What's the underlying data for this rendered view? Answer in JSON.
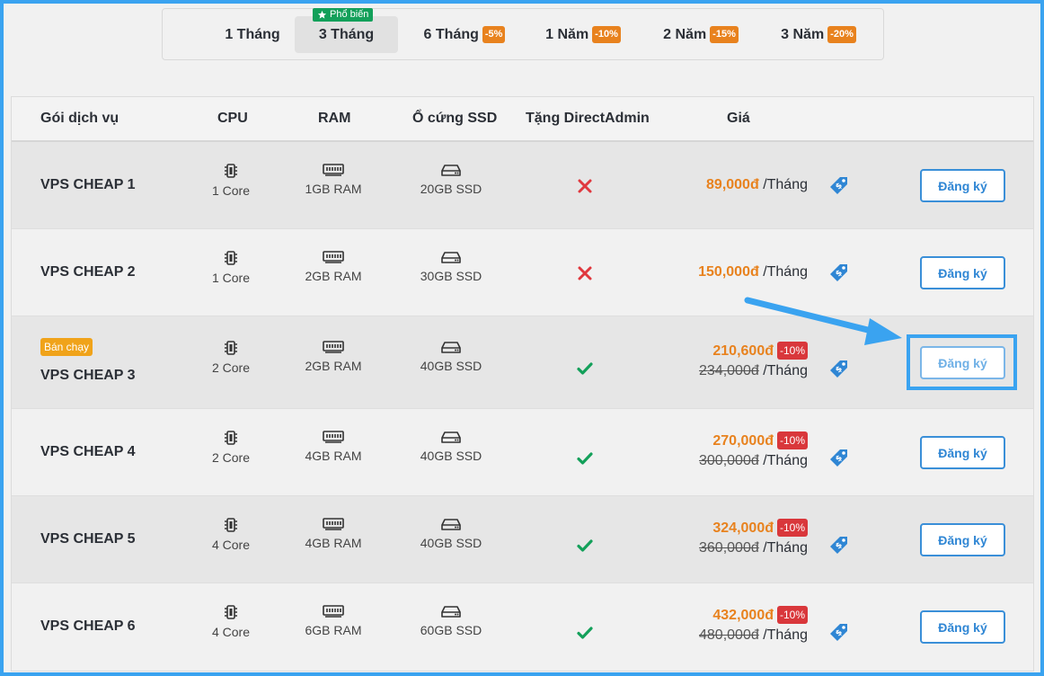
{
  "tabs": [
    {
      "label": "1 Tháng",
      "discount": ""
    },
    {
      "label": "3 Tháng",
      "discount": "",
      "badge": "Phổ biến"
    },
    {
      "label": "6 Tháng",
      "discount": "-5%"
    },
    {
      "label": "1 Năm",
      "discount": "-10%"
    },
    {
      "label": "2 Năm",
      "discount": "-15%"
    },
    {
      "label": "3 Năm",
      "discount": "-20%"
    }
  ],
  "active_tab": "3 Tháng",
  "headers": {
    "package": "Gói dịch vụ",
    "cpu": "CPU",
    "ram": "RAM",
    "ssd": "Ổ cứng SSD",
    "directadmin": "Tặng DirectAdmin",
    "price": "Giá"
  },
  "per_label": "/Tháng",
  "button_label": "Đăng ký",
  "hot_badge": "Bán chạy",
  "plans": [
    {
      "name": "VPS CHEAP 1",
      "cpu": "1 Core",
      "ram": "1GB RAM",
      "ssd": "20GB SSD",
      "directadmin": false,
      "price": "89,000đ",
      "old_price": "",
      "discount": ""
    },
    {
      "name": "VPS CHEAP 2",
      "cpu": "1 Core",
      "ram": "2GB RAM",
      "ssd": "30GB SSD",
      "directadmin": false,
      "price": "150,000đ",
      "old_price": "",
      "discount": ""
    },
    {
      "name": "VPS CHEAP 3",
      "cpu": "2 Core",
      "ram": "2GB RAM",
      "ssd": "40GB SSD",
      "directadmin": true,
      "price": "210,600đ",
      "old_price": "234,000đ",
      "discount": "-10%",
      "hot": true
    },
    {
      "name": "VPS CHEAP 4",
      "cpu": "2 Core",
      "ram": "4GB RAM",
      "ssd": "40GB SSD",
      "directadmin": true,
      "price": "270,000đ",
      "old_price": "300,000đ",
      "discount": "-10%"
    },
    {
      "name": "VPS CHEAP 5",
      "cpu": "4 Core",
      "ram": "4GB RAM",
      "ssd": "40GB SSD",
      "directadmin": true,
      "price": "324,000đ",
      "old_price": "360,000đ",
      "discount": "-10%"
    },
    {
      "name": "VPS CHEAP 6",
      "cpu": "4 Core",
      "ram": "6GB RAM",
      "ssd": "60GB SSD",
      "directadmin": true,
      "price": "432,000đ",
      "old_price": "480,000đ",
      "discount": "-10%"
    }
  ],
  "colors": {
    "accent": "#3aa3f0",
    "price": "#e8821e",
    "discount_red": "#d9373b",
    "check_green": "#13a05a",
    "cross_red": "#e0383e",
    "hot_badge": "#f0a31a"
  },
  "icons": {
    "cpu": "cpu-icon",
    "ram": "ram-icon",
    "ssd": "hard-drive-icon",
    "yes": "check-icon",
    "no": "cross-icon",
    "price_tag": "price-tag-icon",
    "popular": "star-icon"
  }
}
